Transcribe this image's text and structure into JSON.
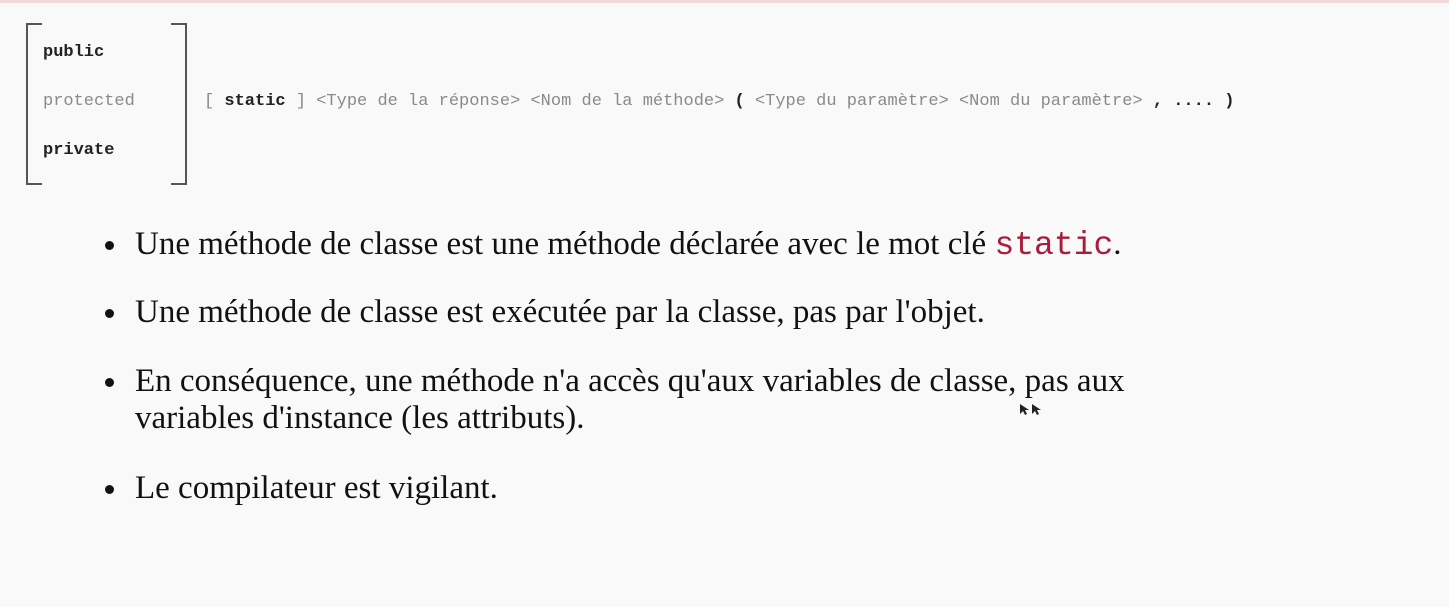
{
  "syntax": {
    "modifiers": [
      "public",
      "protected",
      "private"
    ],
    "open_bracket": "[",
    "static_kw": "static",
    "close_bracket": "]",
    "return_type": "<Type de la réponse>",
    "method_name": "<Nom de la méthode>",
    "open_paren": "(",
    "param_type": "<Type du paramètre>",
    "param_name": "<Nom du paramètre>",
    "ellipsis": ", ....",
    "close_paren": ")"
  },
  "bullets": {
    "b1_text": "Une méthode de classe est une méthode déclarée avec le mot clé ",
    "b1_keyword": "static",
    "b1_end": ".",
    "b2": "Une méthode de classe est exécutée par la classe, pas par l'objet.",
    "b3_line1": "En conséquence, une méthode n'a accès qu'aux variables de classe, pas aux",
    "b3_line2": "variables d'instance (les attributs).",
    "b4": "Le compilateur est vigilant."
  },
  "colors": {
    "keyword": "#a81d3b",
    "text": "#111111",
    "syntax_gray": "#8a8a8a"
  },
  "icons": {
    "cursor": "mouse-pointer-icon"
  }
}
